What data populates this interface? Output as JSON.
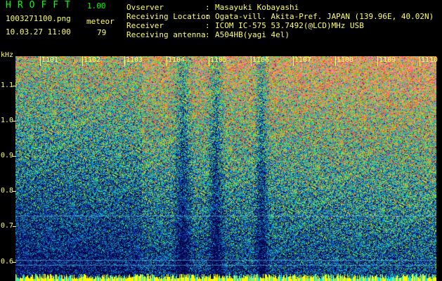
{
  "header": {
    "app_title": "HROFFT",
    "version": "1.00",
    "file_name": "1003271100.png",
    "meteor_label": "meteor",
    "date_time": "10.03.27 11:00",
    "meteor_count": "79"
  },
  "info": [
    {
      "key": "Ovserver",
      "value": "Masayuki Kobayashi"
    },
    {
      "key": "Receiving Location",
      "value": "Ogata-vill. Akita-Pref. JAPAN (139.96E, 40.02N)"
    },
    {
      "key": "Receiver",
      "value": "ICOM IC-575 53.7492(@LCD)MHz USB"
    },
    {
      "key": "Receiving antenna",
      "value": "A504HB(yagi 4el)"
    }
  ],
  "axis": {
    "y_unit": "kHz",
    "y_ticks": [
      "1.1",
      "1.0",
      "0.9",
      "0.8",
      "0.7",
      "0.6"
    ],
    "x_ticks": [
      "1101",
      "1102",
      "1103",
      "1104",
      "1105",
      "1106",
      "1107",
      "1108",
      "1109",
      "1110"
    ]
  },
  "colors": {
    "text": "#ffff66",
    "title": "#00ff00",
    "background": "#000000",
    "low_signal": "#0a2a8a",
    "high_signal": "#ff3030"
  }
}
